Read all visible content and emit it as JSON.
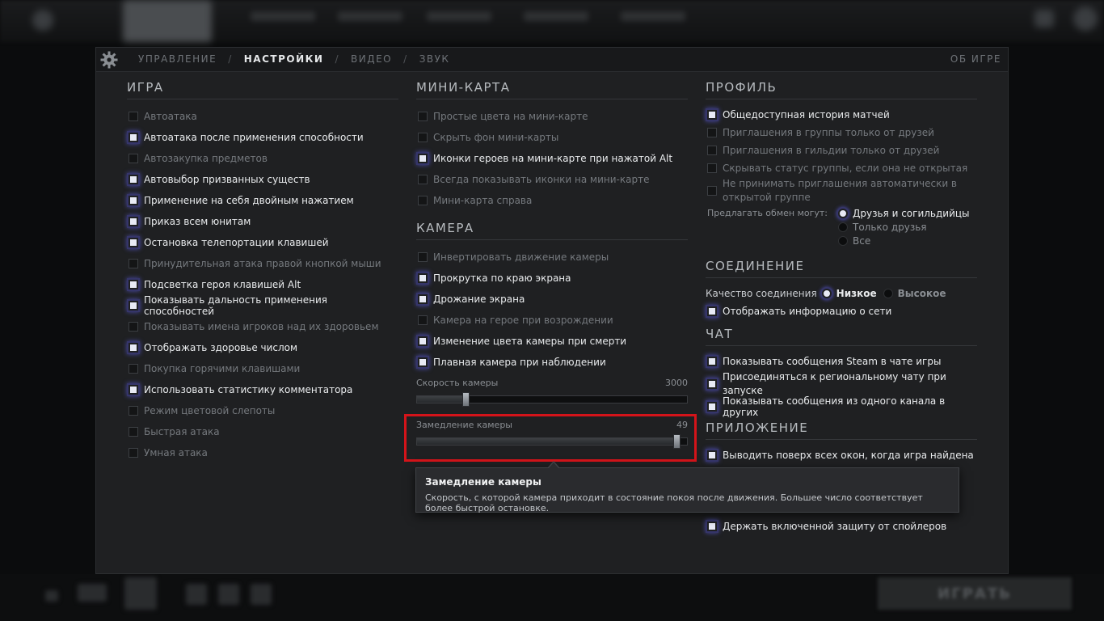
{
  "nav": {
    "tabs": [
      {
        "label": "УПРАВЛЕНИЕ"
      },
      {
        "label": "НАСТРОЙКИ"
      },
      {
        "label": "ВИДЕО"
      },
      {
        "label": "ЗВУК"
      }
    ],
    "active_tab": "НАСТРОЙКИ",
    "about_label": "ОБ ИГРЕ"
  },
  "game": {
    "title": "ИГРА",
    "options": [
      {
        "label": "Автоатака",
        "checked": false
      },
      {
        "label": "Автоатака после применения способности",
        "checked": true
      },
      {
        "label": "Автозакупка предметов",
        "checked": false
      },
      {
        "label": "Автовыбор призванных существ",
        "checked": true
      },
      {
        "label": "Применение на себя двойным нажатием",
        "checked": true
      },
      {
        "label": "Приказ всем юнитам",
        "checked": true
      },
      {
        "label": "Остановка телепортации клавишей",
        "checked": true
      },
      {
        "label": "Принудительная атака правой кнопкой мыши",
        "checked": false
      },
      {
        "label": "Подсветка героя клавишей Alt",
        "checked": true
      },
      {
        "label": "Показывать дальность применения способностей",
        "checked": true
      },
      {
        "label": "Показывать имена игроков над их здоровьем",
        "checked": false
      },
      {
        "label": "Отображать здоровье числом",
        "checked": true
      },
      {
        "label": "Покупка горячими клавишами",
        "checked": false
      },
      {
        "label": "Использовать статистику комментатора",
        "checked": true
      },
      {
        "label": "Режим цветовой слепоты",
        "checked": false
      },
      {
        "label": "Быстрая атака",
        "checked": false
      },
      {
        "label": "Умная атака",
        "checked": false
      }
    ]
  },
  "minimap": {
    "title": "МИНИ-КАРТА",
    "options": [
      {
        "label": "Простые цвета на мини-карте",
        "checked": false
      },
      {
        "label": "Скрыть фон мини-карты",
        "checked": false
      },
      {
        "label": "Иконки героев на мини-карте при нажатой Alt",
        "checked": true
      },
      {
        "label": "Всегда показывать иконки на мини-карте",
        "checked": false
      },
      {
        "label": "Мини-карта справа",
        "checked": false
      }
    ]
  },
  "camera": {
    "title": "КАМЕРА",
    "options": [
      {
        "label": "Инвертировать движение камеры",
        "checked": false
      },
      {
        "label": "Прокрутка по краю экрана",
        "checked": true
      },
      {
        "label": "Дрожание экрана",
        "checked": true
      },
      {
        "label": "Камера на герое при возрождении",
        "checked": false
      },
      {
        "label": "Изменение цвета камеры при смерти",
        "checked": true
      },
      {
        "label": "Плавная камера при наблюдении",
        "checked": true
      }
    ],
    "speed": {
      "label": "Скорость камеры",
      "value": "3000",
      "fraction": 0.18
    },
    "slowdown": {
      "label": "Замедление камеры",
      "value": "49",
      "fraction": 0.96
    }
  },
  "profile": {
    "title": "ПРОФИЛЬ",
    "options": [
      {
        "label": "Общедоступная история матчей",
        "checked": true
      },
      {
        "label": "Приглашения в группы только от друзей",
        "checked": false
      },
      {
        "label": "Приглашения в гильдии только от друзей",
        "checked": false
      },
      {
        "label": "Скрывать статус группы, если она не открытая",
        "checked": false
      },
      {
        "label": "Не принимать приглашения автоматически в открытой группе",
        "checked": false
      }
    ],
    "trade_label": "Предлагать обмен могут:",
    "trade_options": [
      {
        "label": "Друзья и согильдийцы",
        "selected": true
      },
      {
        "label": "Только друзья",
        "selected": false
      },
      {
        "label": "Все",
        "selected": false
      }
    ]
  },
  "connection": {
    "title": "СОЕДИНЕНИЕ",
    "quality_label": "Качество соединения",
    "quality_options": [
      {
        "label": "Низкое",
        "selected": true
      },
      {
        "label": "Высокое",
        "selected": false
      }
    ],
    "options": [
      {
        "label": "Отображать информацию о сети",
        "checked": true
      }
    ]
  },
  "chat": {
    "title": "ЧАТ",
    "options": [
      {
        "label": "Показывать сообщения Steam в чате игры",
        "checked": true
      },
      {
        "label": "Присоединяться к региональному чату при запуске",
        "checked": true
      },
      {
        "label": "Показывать сообщения из одного канала в других",
        "checked": true
      }
    ]
  },
  "app": {
    "title": "ПРИЛОЖЕНИЕ",
    "options": [
      {
        "label": "Выводить поверх всех окон, когда игра найдена",
        "checked": true
      }
    ],
    "spoiler_option": {
      "label": "Держать включенной защиту от спойлеров",
      "checked": true
    }
  },
  "tooltip": {
    "title": "Замедление камеры",
    "description": "Скорость, с которой камера приходит в состояние покоя после движения. Большее число соответствует более быстрой остановке."
  },
  "bottom": {
    "play_label": "ИГРАТЬ"
  },
  "colors": {
    "accent_highlight": "#d4141a",
    "checkbox_glow": "#4b4ba8",
    "panel_bg": "#1f2022"
  }
}
